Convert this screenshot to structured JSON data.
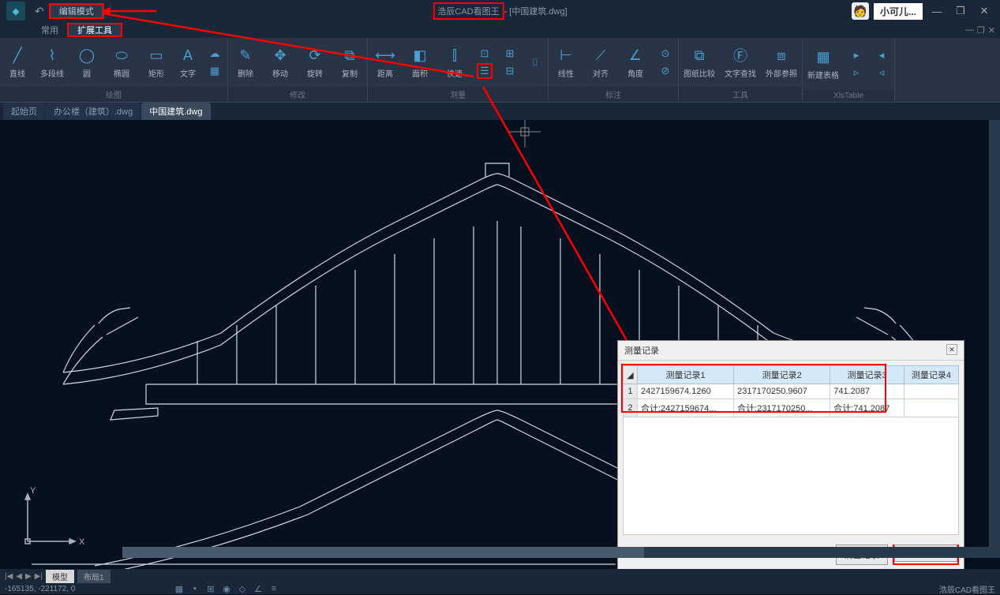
{
  "titlebar": {
    "edit_mode": "编辑模式",
    "title_highlighted": "浩辰CAD看图王",
    "title_suffix": " - [中国建筑.dwg]",
    "username": "小可儿..."
  },
  "menu": {
    "tab1": "常用",
    "tab2": "扩展工具"
  },
  "ribbon": {
    "draw": {
      "line": "直线",
      "polyline": "多段线",
      "circle": "圆",
      "ellipse": "椭圆",
      "rect": "矩形",
      "text": "文字",
      "group": "绘图"
    },
    "modify": {
      "delete": "删除",
      "move": "移动",
      "rotate": "旋转",
      "copy": "复制",
      "group": "修改"
    },
    "measure": {
      "distance": "距离",
      "area": "面积",
      "quick": "快速",
      "group": "测量"
    },
    "annotate": {
      "linear": "线性",
      "aligned": "对齐",
      "angular": "角度",
      "group": "标注"
    },
    "tools": {
      "compare": "图纸比较",
      "findtext": "文字查找",
      "xref": "外部参照",
      "group": "工具"
    },
    "xls": {
      "newtable": "新建表格",
      "group": "XlsTable"
    }
  },
  "filetabs": {
    "tab1": "起始页",
    "tab2": "办公楼（建筑）.dwg",
    "tab3": "中国建筑.dwg"
  },
  "dialog": {
    "title": "测量记录",
    "headers": {
      "c1": "测量记录1",
      "c2": "测量记录2",
      "c3": "测量记录3",
      "c4": "测量记录4"
    },
    "rows": [
      {
        "n": "1",
        "c1": "2427159674.1260",
        "c2": "2317170250.9607",
        "c3": "741.2087",
        "c4": ""
      },
      {
        "n": "2",
        "c1": "合计:2427159674...",
        "c2": "合计:2317170250...",
        "c3": "合计:741.2087",
        "c4": ""
      }
    ],
    "btn_clear": "清空记录",
    "btn_export": "导出EXCEL"
  },
  "bottom": {
    "model": "模型",
    "layout1": "布局1"
  },
  "status": {
    "coords": "-165135, -221172, 0",
    "brand": "浩辰CAD看图王"
  }
}
